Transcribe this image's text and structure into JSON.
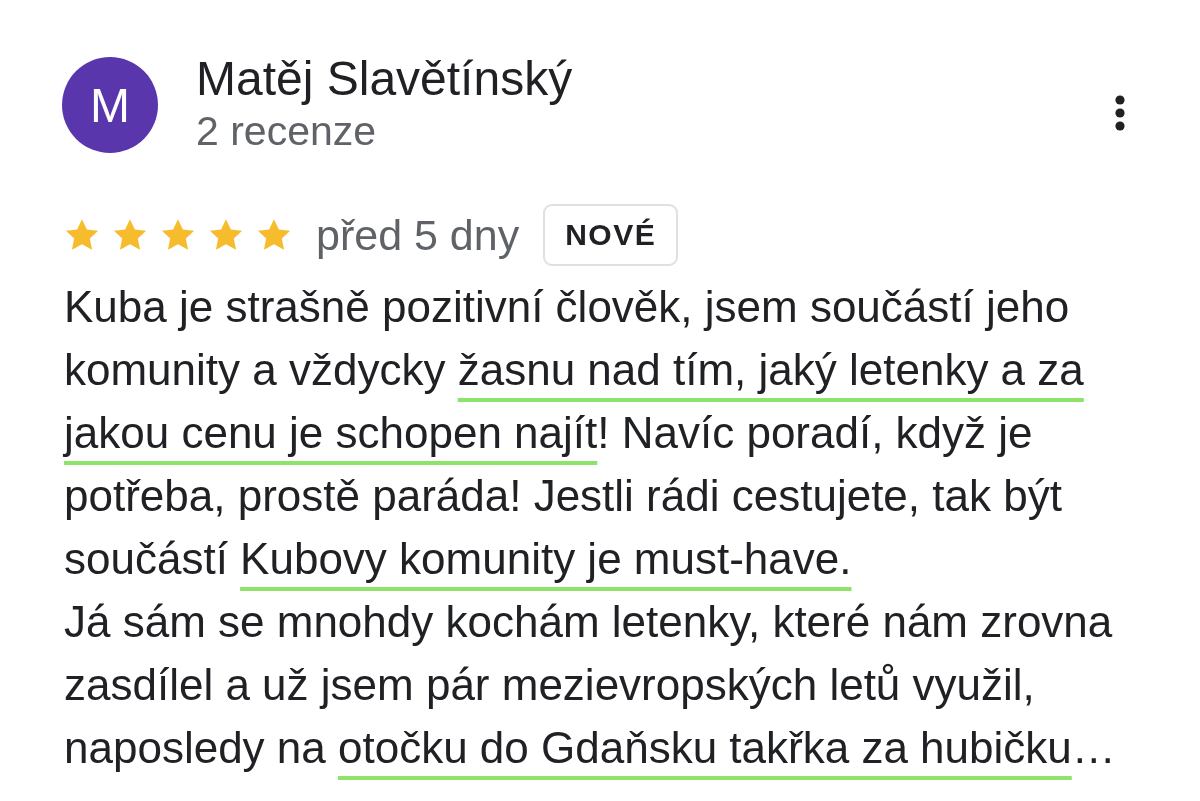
{
  "review": {
    "author": {
      "initial": "M",
      "name": "Matěj Slavětínský",
      "review_count": "2 recenze"
    },
    "stars": 5,
    "time": "před 5 dny",
    "badge": "NOVÉ",
    "paragraphs": [
      {
        "segments": [
          {
            "text": "Kuba je strašně pozitivní člověk, jsem součástí jeho komunity a vždycky ",
            "underlined": false
          },
          {
            "text": "žasnu nad tím, jaký letenky a za jakou cenu je schopen najít",
            "underlined": true
          },
          {
            "text": "! Navíc poradí, když je potřeba, prostě paráda! Jestli rádi cestujete, tak být součástí ",
            "underlined": false
          },
          {
            "text": "Kubovy komunity je must-have.",
            "underlined": true
          }
        ]
      },
      {
        "segments": [
          {
            "text": "Já sám se mnohdy kochám letenky, které nám zrovna zasdílel a už jsem pár mezievropských letů využil, naposledy na ",
            "underlined": false
          },
          {
            "text": "otočku do Gdaňsku takřka za hubičku",
            "underlined": true
          },
          {
            "text": "…",
            "underlined": false
          }
        ]
      }
    ]
  }
}
